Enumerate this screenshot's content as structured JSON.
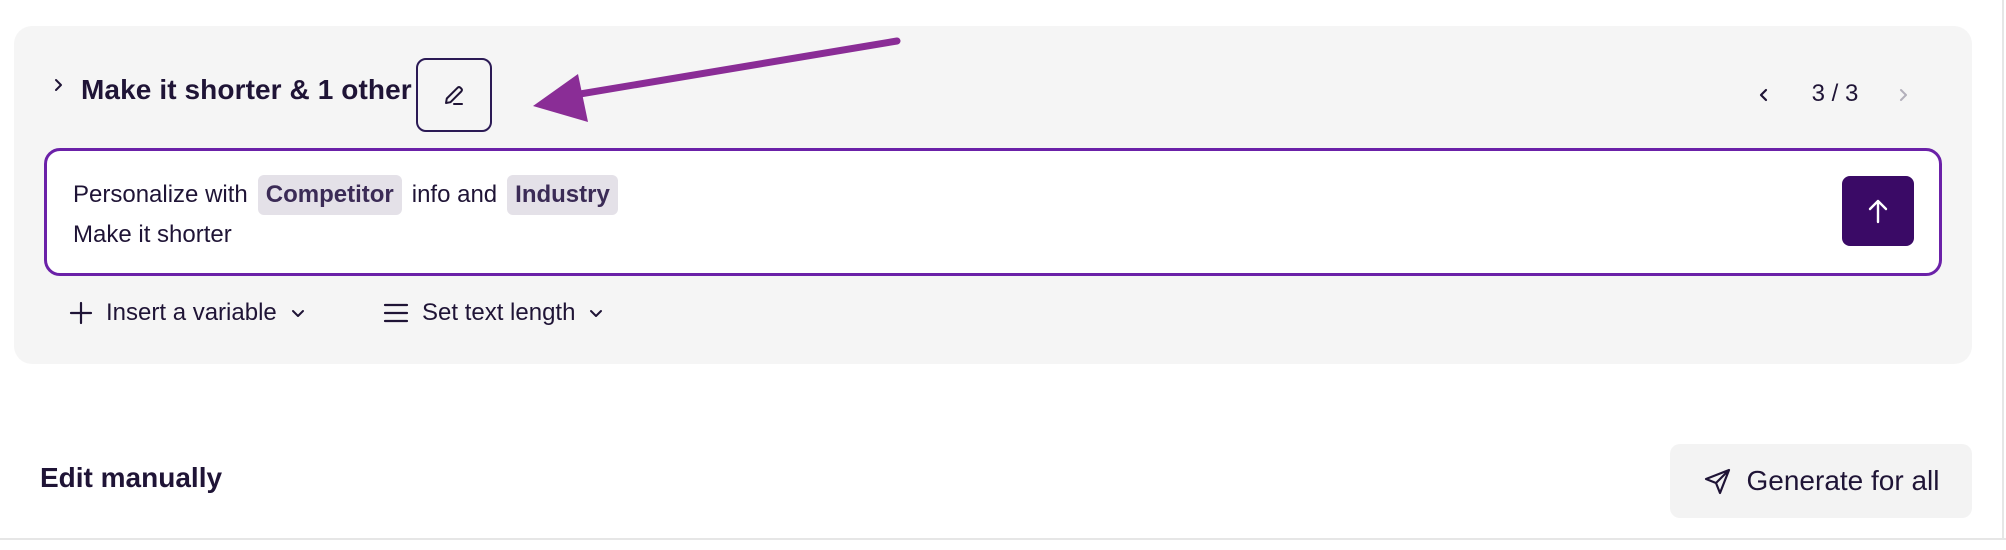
{
  "prompt_header": {
    "title": "Make it shorter & 1 other",
    "edit_icon": "pencil-icon",
    "collapse_icon": "chevron-right-icon"
  },
  "pager": {
    "label": "3 / 3",
    "prev_icon": "chevron-left-icon",
    "next_icon": "chevron-right-icon"
  },
  "prompt_input": {
    "line1_prefix": "Personalize with",
    "variable_1": "Competitor",
    "line1_middle": "info and",
    "variable_2": "Industry",
    "line2": "Make it shorter",
    "send_icon": "arrow-up-icon"
  },
  "tools": {
    "insert_variable_label": "Insert a variable",
    "set_text_length_label": "Set text length",
    "insert_icon": "plus-icon",
    "length_icon": "lines-icon",
    "dropdown_icon": "chevron-down-icon"
  },
  "actions": {
    "edit_manually_label": "Edit manually",
    "generate_label": "Generate for all",
    "generate_icon": "send-icon"
  },
  "colors": {
    "accent_purple": "#6b21a8",
    "send_button_bg": "#3a0a66",
    "annotation_arrow": "#8a2d96",
    "card_bg": "#f5f5f5",
    "chip_bg": "#e4e1e8",
    "text_primary": "#1f1436"
  }
}
